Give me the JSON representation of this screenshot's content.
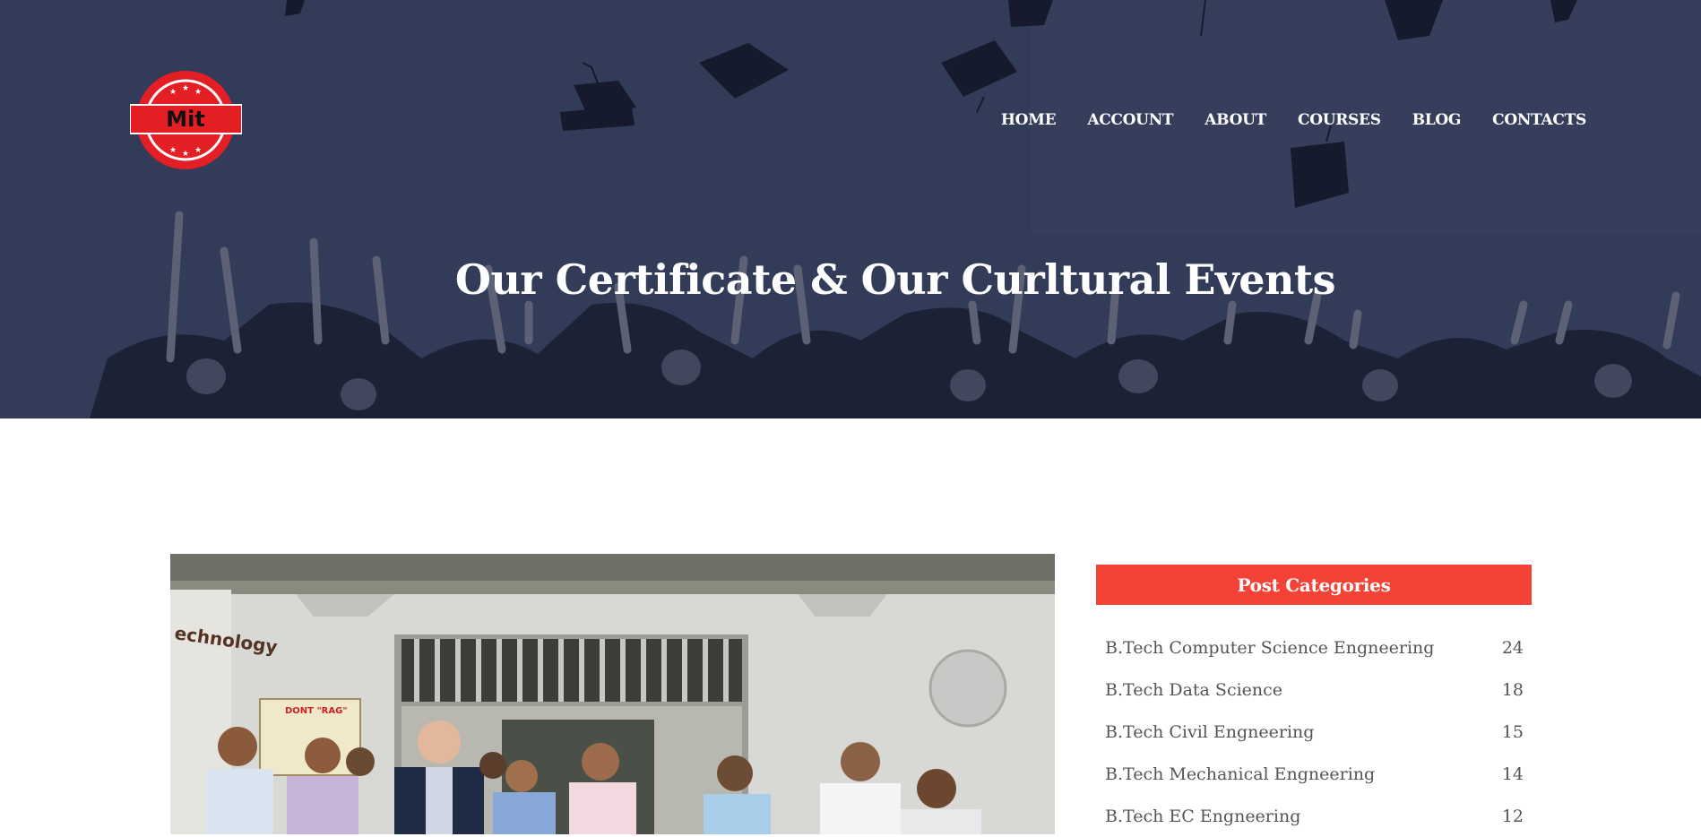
{
  "brand": {
    "logo_text": "Mit"
  },
  "nav": {
    "items": [
      {
        "label": "HOME"
      },
      {
        "label": "ACCOUNT"
      },
      {
        "label": "ABOUT"
      },
      {
        "label": "COURSES"
      },
      {
        "label": "BLOG"
      },
      {
        "label": "CONTACTS"
      }
    ]
  },
  "hero": {
    "title": "Our Certificate & Our Curltural Events"
  },
  "sidebar": {
    "title": "Post Categories",
    "categories": [
      {
        "label": "B.Tech Computer Science Engneering",
        "count": "24"
      },
      {
        "label": "B.Tech Data Science",
        "count": "18"
      },
      {
        "label": "B.Tech Civil Engneering",
        "count": "15"
      },
      {
        "label": "B.Tech Mechanical Engneering",
        "count": "14"
      },
      {
        "label": "B.Tech EC Engneering",
        "count": "12"
      }
    ]
  },
  "photo": {
    "sign_text": "DONT \"RAG\"",
    "wall_text": "echnology"
  },
  "colors": {
    "accent": "#f44336",
    "hero_overlay": "#2f3856",
    "nav_text": "#ffffff",
    "logo_red": "#e31e24"
  }
}
